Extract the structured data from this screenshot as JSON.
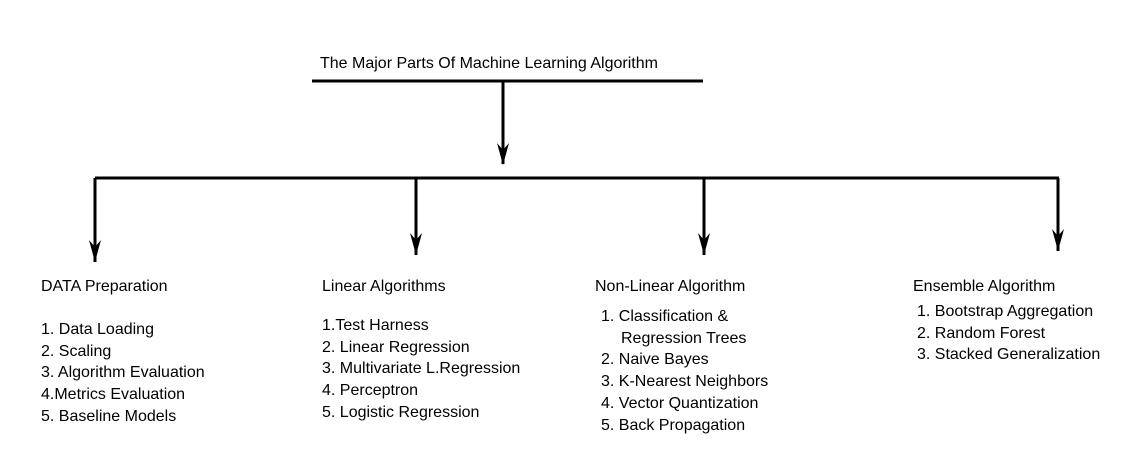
{
  "root": {
    "title": "The Major Parts Of Machine Learning Algorithm"
  },
  "branches": [
    {
      "title": "DATA Preparation",
      "items": [
        "1. Data Loading",
        "2. Scaling",
        "3. Algorithm Evaluation",
        "4.Metrics Evaluation",
        "5. Baseline Models"
      ]
    },
    {
      "title": "Linear Algorithms",
      "items": [
        "1.Test Harness",
        "2. Linear Regression",
        "3. Multivariate L.Regression",
        "4. Perceptron",
        "5. Logistic Regression"
      ]
    },
    {
      "title": "Non-Linear Algorithm",
      "items": [
        "1. Classification &",
        "Regression Trees",
        "2. Naive Bayes",
        "3. K-Nearest Neighbors",
        "4. Vector Quantization",
        "5. Back Propagation"
      ]
    },
    {
      "title": "Ensemble Algorithm",
      "items": [
        "1. Bootstrap Aggregation",
        "2. Random Forest",
        "3. Stacked Generalization"
      ]
    }
  ],
  "colors": {
    "line": "#000000",
    "text": "#000000",
    "background": "#ffffff"
  }
}
